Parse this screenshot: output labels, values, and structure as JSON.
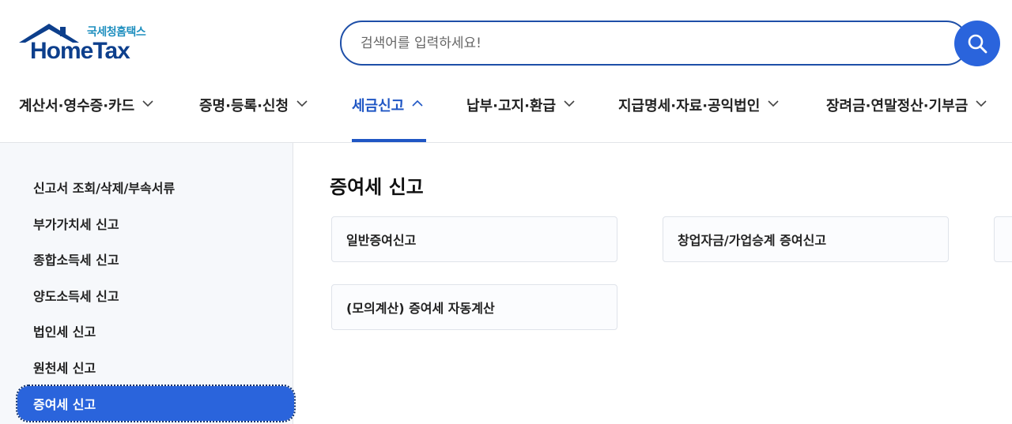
{
  "brand": {
    "name_kr": "국세청홈택스",
    "name_en": "HomeTax"
  },
  "search": {
    "placeholder": "검색어를 입력하세요!",
    "value": ""
  },
  "gnb": {
    "items": [
      {
        "label": "계산서·영수증·카드",
        "expanded": false
      },
      {
        "label": "증명·등록·신청",
        "expanded": false
      },
      {
        "label": "세금신고",
        "expanded": true
      },
      {
        "label": "납부·고지·환급",
        "expanded": false
      },
      {
        "label": "지급명세·자료·공익법인",
        "expanded": false
      },
      {
        "label": "장려금·연말정산·기부금",
        "expanded": false
      }
    ]
  },
  "sidebar": {
    "items": [
      {
        "label": "신고서 조회/삭제/부속서류"
      },
      {
        "label": "부가가치세 신고"
      },
      {
        "label": "종합소득세 신고"
      },
      {
        "label": "양도소득세 신고"
      },
      {
        "label": "법인세 신고"
      },
      {
        "label": "원천세 신고"
      },
      {
        "label": "증여세 신고",
        "active": true
      }
    ]
  },
  "main": {
    "title": "증여세 신고",
    "cards": [
      {
        "label": "일반증여신고"
      },
      {
        "label": "창업자금/가업승계 증여신고"
      },
      {
        "label": "(모의계산) 증여세 자동계산"
      }
    ]
  },
  "colors": {
    "brand_navy": "#0d3f8c",
    "brand_teal": "#1f8fbf",
    "accent_blue": "#2a64dc",
    "active_nav": "#1f56c4"
  }
}
